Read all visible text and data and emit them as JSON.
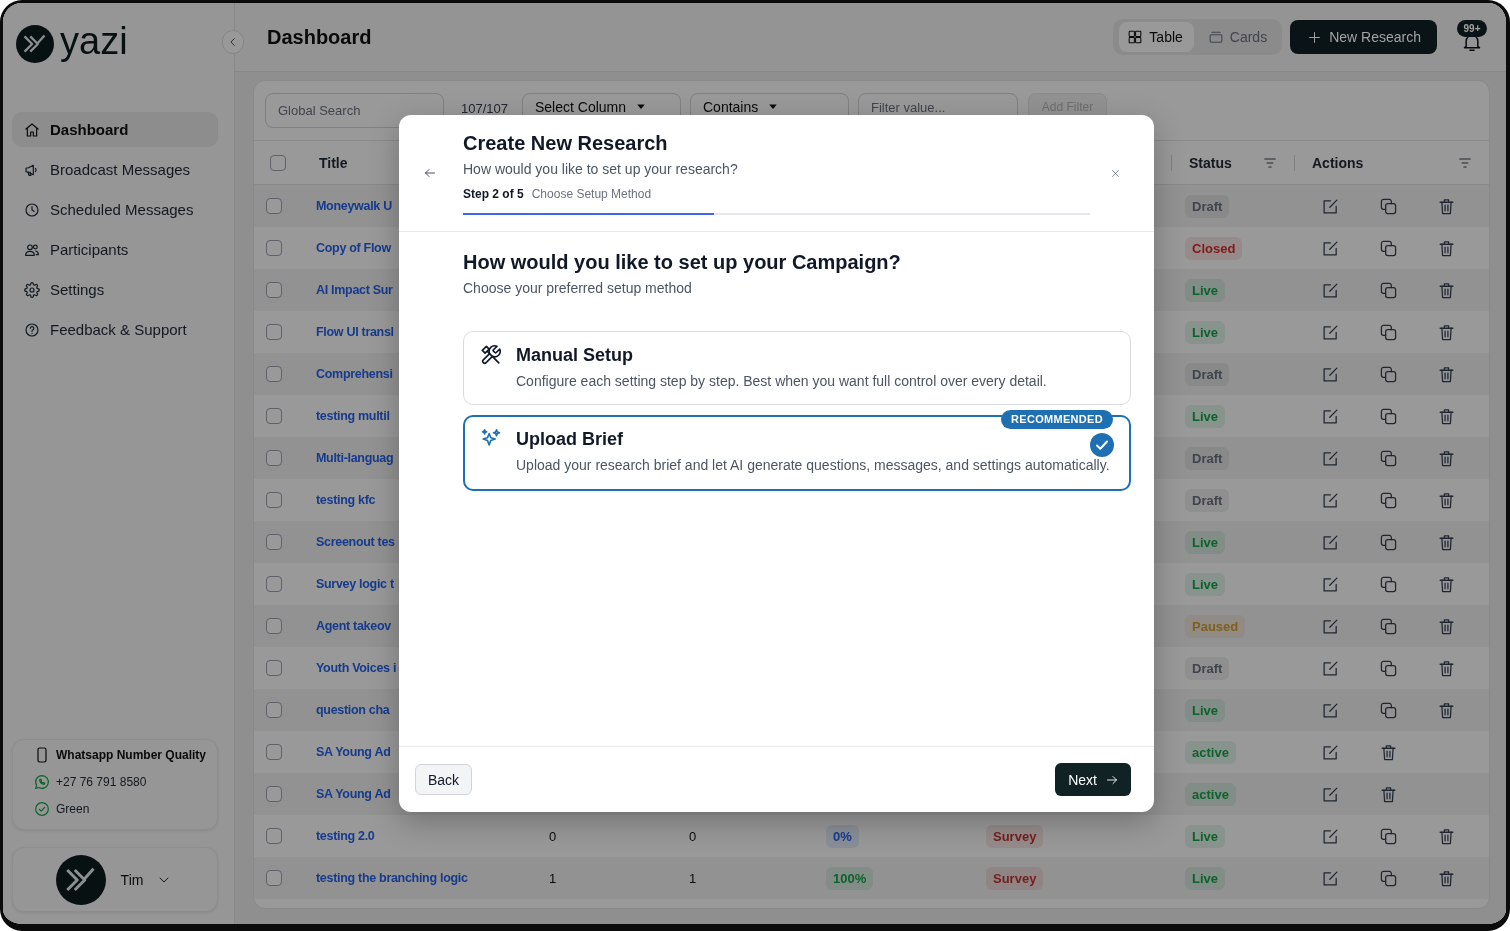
{
  "sidebar": {
    "brand": "yazi",
    "nav": [
      {
        "label": "Dashboard",
        "selected": true
      },
      {
        "label": "Broadcast Messages",
        "selected": false
      },
      {
        "label": "Scheduled Messages",
        "selected": false
      },
      {
        "label": "Participants",
        "selected": false
      },
      {
        "label": "Settings",
        "selected": false
      },
      {
        "label": "Feedback & Support",
        "selected": false
      }
    ],
    "number_quality": {
      "title": "Whatsapp Number Quality",
      "number": "+27 76 791 8580",
      "quality": "Green"
    },
    "user": {
      "name": "Tim"
    }
  },
  "header": {
    "title": "Dashboard",
    "view_toggle": [
      {
        "label": "Table",
        "selected": true
      },
      {
        "label": "Cards",
        "selected": false
      }
    ],
    "new_button": "New Research",
    "notification_count": "99+"
  },
  "filters": {
    "search_placeholder": "Global Search",
    "count": "107/107",
    "column_select": "Select Column",
    "operator_select": "Contains",
    "value_placeholder": "Filter value...",
    "add_filter": {
      "label": "Add Filter",
      "disabled": true
    }
  },
  "table": {
    "select_all_checked": false,
    "title_column": "Title",
    "status_column": "Status",
    "actions_column": "Actions",
    "rows": [
      {
        "checked": false,
        "title": "Moneywalk U",
        "status": {
          "text": "Draft",
          "color": "#40444d"
        },
        "actions": [
          {
            "kind": "edit"
          },
          {
            "kind": "copy"
          },
          {
            "kind": "delete"
          }
        ]
      },
      {
        "checked": false,
        "title": "Copy of Flow",
        "status": {
          "text": "Closed",
          "color": "#841717"
        },
        "actions": [
          {
            "kind": "edit"
          },
          {
            "kind": "copy"
          },
          {
            "kind": "delete"
          }
        ]
      },
      {
        "checked": false,
        "title": "AI Impact Sur",
        "status": {
          "text": "Live",
          "color": "#0d622c"
        },
        "actions": [
          {
            "kind": "edit"
          },
          {
            "kind": "copy"
          },
          {
            "kind": "delete"
          }
        ]
      },
      {
        "checked": false,
        "title": "Flow UI transl",
        "status": {
          "text": "Live",
          "color": "#0d622c"
        },
        "actions": [
          {
            "kind": "edit"
          },
          {
            "kind": "copy"
          },
          {
            "kind": "delete"
          }
        ]
      },
      {
        "checked": false,
        "title": "Comprehensi",
        "status": {
          "text": "Draft",
          "color": "#40444d"
        },
        "actions": [
          {
            "kind": "edit"
          },
          {
            "kind": "copy"
          },
          {
            "kind": "delete"
          }
        ]
      },
      {
        "checked": false,
        "title": "testing multil",
        "status": {
          "text": "Live",
          "color": "#0d622c"
        },
        "actions": [
          {
            "kind": "edit"
          },
          {
            "kind": "copy"
          },
          {
            "kind": "delete"
          }
        ]
      },
      {
        "checked": false,
        "title": "Multi-languag",
        "status": {
          "text": "Draft",
          "color": "#40444d"
        },
        "actions": [
          {
            "kind": "edit"
          },
          {
            "kind": "copy"
          },
          {
            "kind": "delete"
          }
        ]
      },
      {
        "checked": false,
        "title": "testing kfc",
        "status": {
          "text": "Draft",
          "color": "#40444d"
        },
        "actions": [
          {
            "kind": "edit"
          },
          {
            "kind": "copy"
          },
          {
            "kind": "delete"
          }
        ]
      },
      {
        "checked": false,
        "title": "Screenout tes",
        "status": {
          "text": "Live",
          "color": "#0d622c"
        },
        "actions": [
          {
            "kind": "edit"
          },
          {
            "kind": "copy"
          },
          {
            "kind": "delete"
          }
        ]
      },
      {
        "checked": false,
        "title": "Survey logic t",
        "status": {
          "text": "Live",
          "color": "#0d622c"
        },
        "actions": [
          {
            "kind": "edit"
          },
          {
            "kind": "copy"
          },
          {
            "kind": "delete"
          }
        ]
      },
      {
        "checked": false,
        "title": "Agent takeov",
        "status": {
          "text": "Paused",
          "color": "#805f1c"
        },
        "actions": [
          {
            "kind": "edit"
          },
          {
            "kind": "copy"
          },
          {
            "kind": "delete"
          }
        ]
      },
      {
        "checked": false,
        "title": "Youth Voices i",
        "status": {
          "text": "Draft",
          "color": "#40444d"
        },
        "actions": [
          {
            "kind": "edit"
          },
          {
            "kind": "copy"
          },
          {
            "kind": "delete"
          }
        ]
      },
      {
        "checked": false,
        "title": "question cha",
        "status": {
          "text": "Live",
          "color": "#0d622c"
        },
        "actions": [
          {
            "kind": "edit"
          },
          {
            "kind": "copy"
          },
          {
            "kind": "delete"
          }
        ]
      },
      {
        "checked": false,
        "title": "SA Young Ad",
        "status": {
          "text": "active",
          "color": "#0d622c"
        },
        "actions": [
          {
            "kind": "edit"
          },
          {
            "kind": "delete"
          }
        ]
      },
      {
        "checked": false,
        "title": "SA Young Ad",
        "status": {
          "text": "active",
          "color": "#0d622c"
        },
        "actions": [
          {
            "kind": "edit"
          },
          {
            "kind": "delete"
          }
        ]
      },
      {
        "checked": false,
        "title": "testing 2.0",
        "column_2": "0",
        "column_3": "0",
        "column_4": {
          "text": "0%",
          "color": "#163b8d"
        },
        "column_5": {
          "text": "Survey",
          "color": "#761d1d"
        },
        "status": {
          "text": "Live",
          "color": "#0d622c"
        },
        "actions": [
          {
            "kind": "edit"
          },
          {
            "kind": "copy"
          },
          {
            "kind": "delete"
          }
        ]
      },
      {
        "checked": false,
        "title": "testing the branching logic",
        "column_2": "1",
        "column_3": "1",
        "column_4": {
          "text": "100%",
          "color": "#0d622c"
        },
        "column_5": {
          "text": "Survey",
          "color": "#761d1d"
        },
        "status": {
          "text": "Live",
          "color": "#0d622c"
        },
        "actions": [
          {
            "kind": "edit"
          },
          {
            "kind": "copy"
          },
          {
            "kind": "delete"
          }
        ]
      }
    ]
  },
  "modal": {
    "title": "Create New Research",
    "subtitle": "How would you like to set up your research?",
    "step": "Step 2 of 5",
    "step_name": "Choose Setup Method",
    "progress": {
      "level": 0.4
    },
    "heading": "How would you like to set up your Campaign?",
    "subheading": "Choose your preferred setup method",
    "options": [
      {
        "title": "Manual Setup",
        "description": "Configure each setting step by step. Best when you want full control over every detail.",
        "selected": false
      },
      {
        "title": "Upload Brief",
        "description": "Upload your research brief and let AI generate questions, messages, and settings automatically.",
        "selected": true,
        "badge": "RECOMMENDED"
      }
    ],
    "back_button": "Back",
    "next_button": "Next"
  }
}
